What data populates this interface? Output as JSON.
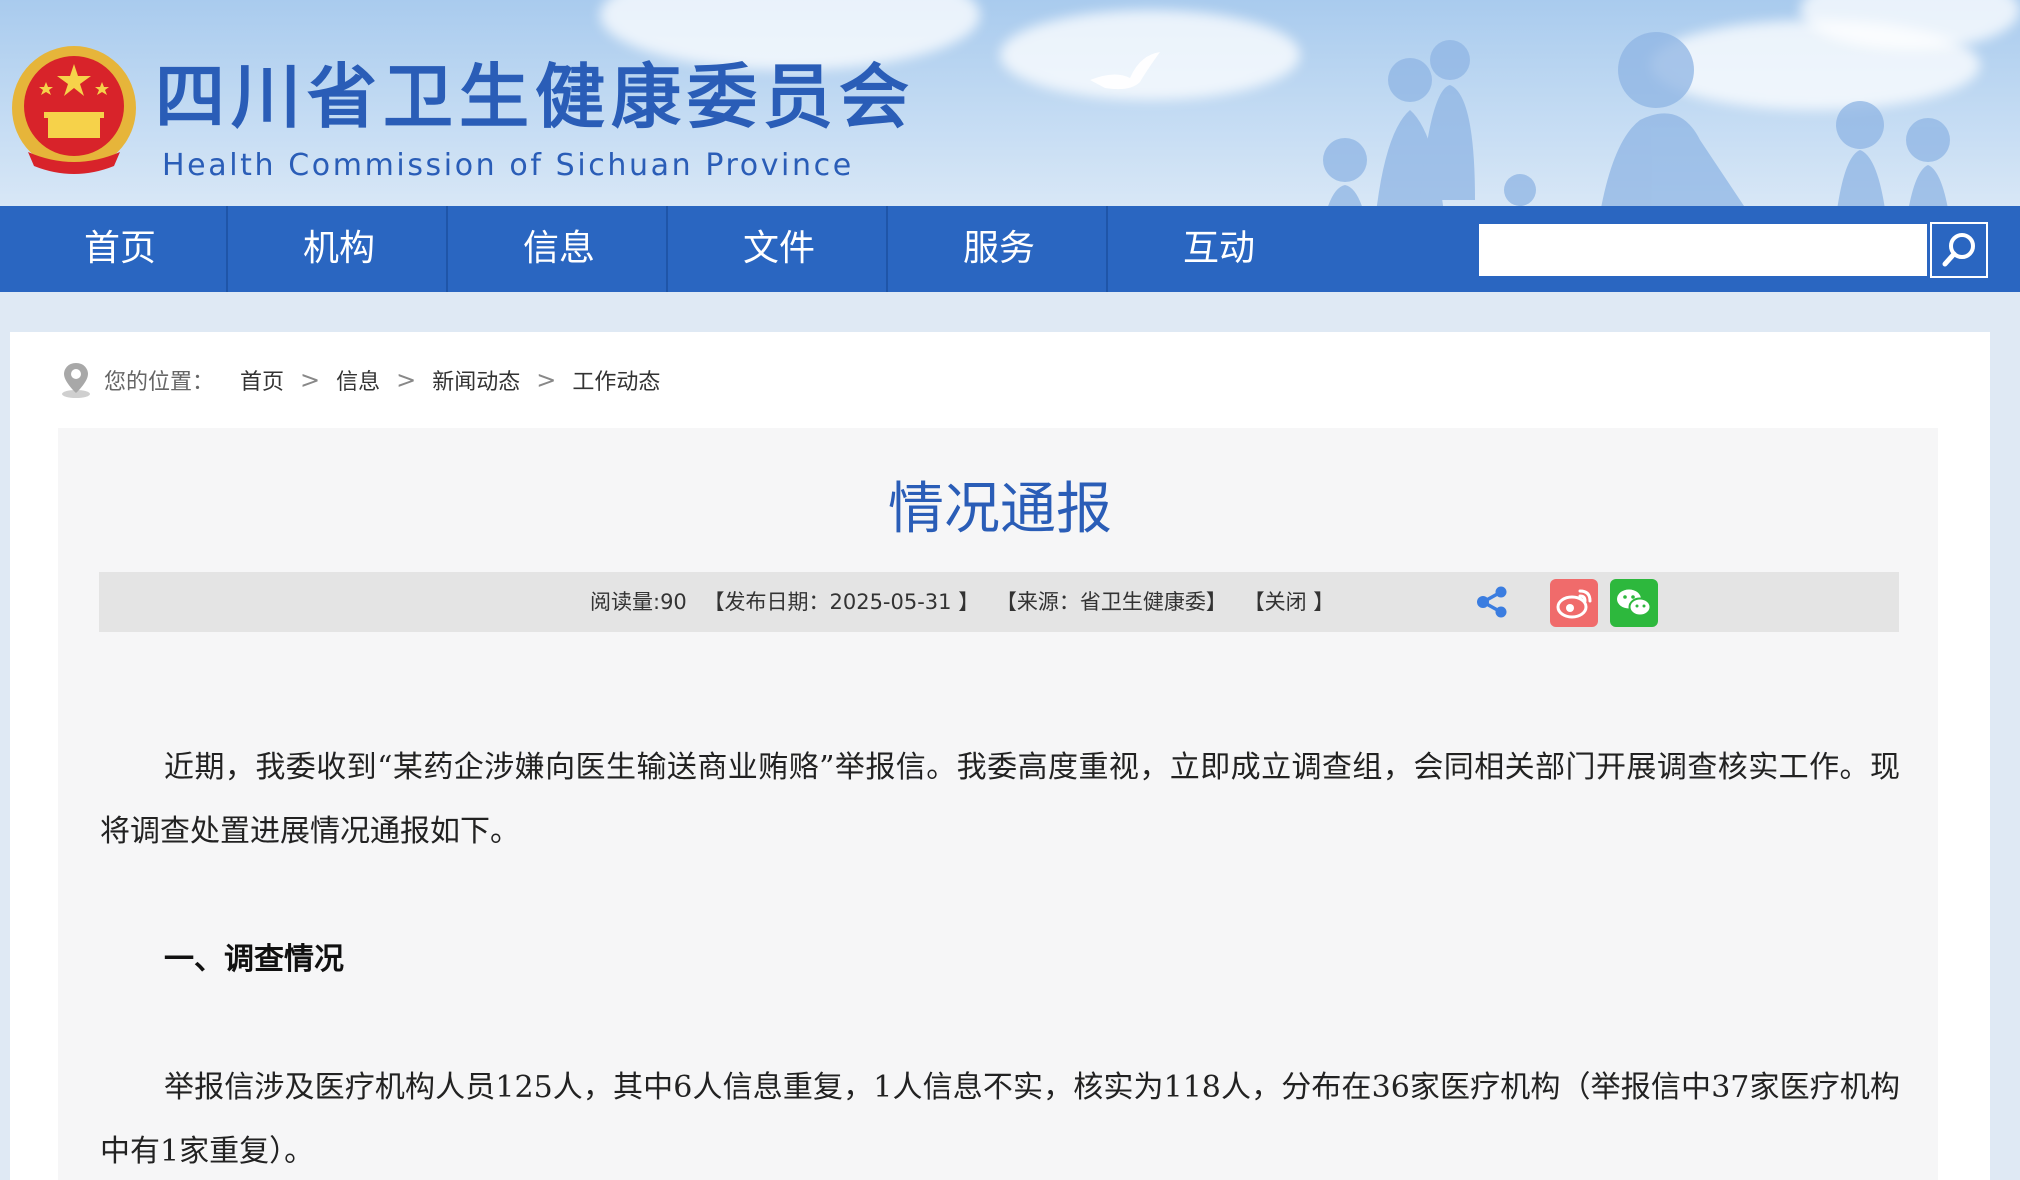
{
  "header": {
    "site_title": "四川省卫生健康委员会",
    "site_subtitle": "Health Commission of Sichuan Province",
    "emblem_icon": "national-emblem-icon"
  },
  "nav": {
    "items": [
      "首页",
      "机构",
      "信息",
      "文件",
      "服务",
      "互动"
    ],
    "search_placeholder": "",
    "search_icon": "search-icon"
  },
  "breadcrumb": {
    "label": "您的位置：",
    "items": [
      "首页",
      "信息",
      "新闻动态",
      "工作动态"
    ],
    "separator": ">"
  },
  "article": {
    "title": "情况通报",
    "meta": {
      "views": "阅读量:90",
      "date": "【发布日期：2025-05-31 】",
      "source": "【来源：省卫生健康委】",
      "close": "【关闭 】"
    },
    "share_icons": [
      "share-icon",
      "weibo-icon",
      "wechat-icon"
    ],
    "paragraphs": [
      "近期，我委收到“某药企涉嫌向医生输送商业贿赂”举报信。我委高度重视，立即成立调查组，会同相关部门开展调查核实工作。现将调查处置进展情况通报如下。",
      "一、调查情况",
      "举报信涉及医疗机构人员125人，其中6人信息重复，1人信息不实，核实为118人，分布在36家医疗机构（举报信中37家医疗机构中有1家重复）。"
    ]
  },
  "colors": {
    "nav_blue": "#2a66c1",
    "title_blue": "#2a5db7",
    "weibo_red": "#f06b6b",
    "wechat_green": "#2db83d"
  }
}
